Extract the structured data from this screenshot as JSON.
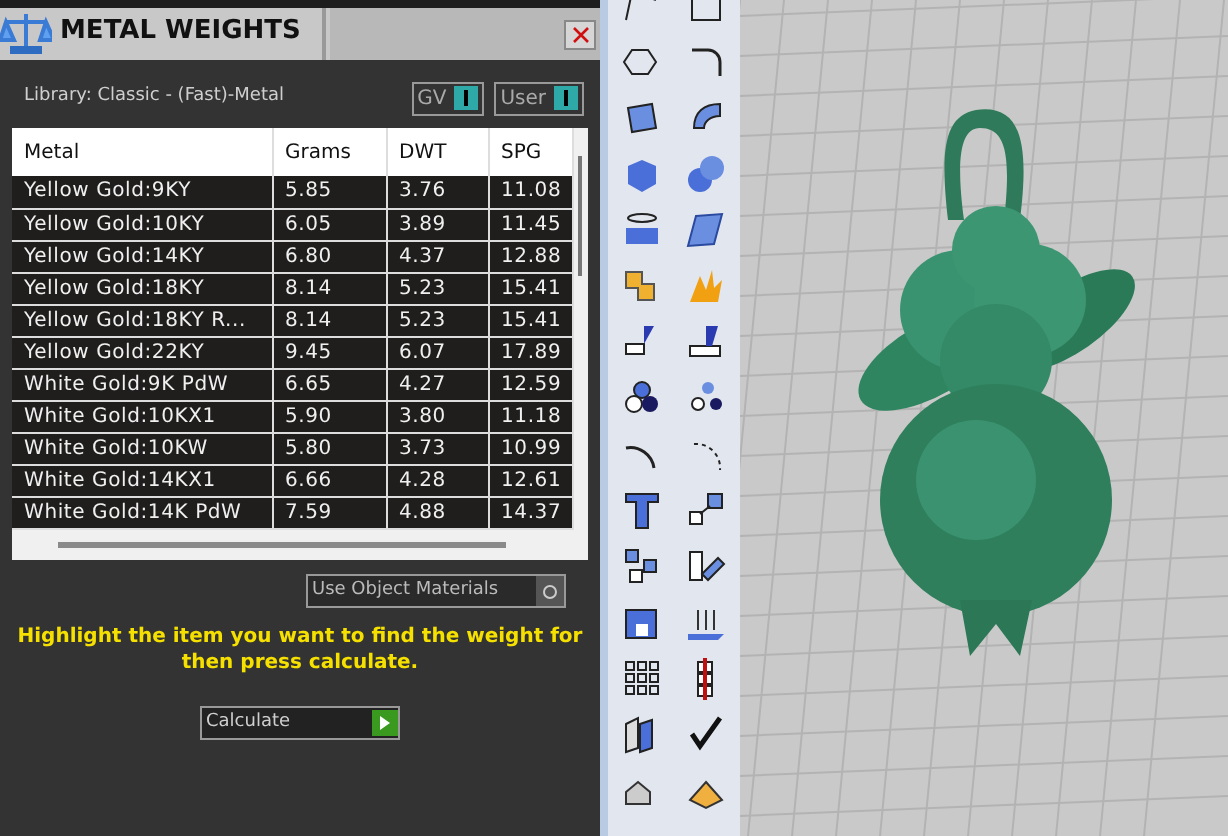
{
  "panel": {
    "title": "METAL WEIGHTS",
    "library": "Library: Classic - (Fast)-Metal",
    "toggles": [
      {
        "label": "GV",
        "on": true
      },
      {
        "label": "User",
        "on": true
      }
    ],
    "table": {
      "columns": [
        "Metal",
        "Grams",
        "DWT",
        "SPG"
      ],
      "rows": [
        [
          "Yellow Gold:9KY",
          "5.85",
          "3.76",
          "11.08"
        ],
        [
          "Yellow Gold:10KY",
          "6.05",
          "3.89",
          "11.45"
        ],
        [
          "Yellow Gold:14KY",
          "6.80",
          "4.37",
          "12.88"
        ],
        [
          "Yellow Gold:18KY",
          "8.14",
          "5.23",
          "15.41"
        ],
        [
          "Yellow Gold:18KY R...",
          "8.14",
          "5.23",
          "15.41"
        ],
        [
          "Yellow Gold:22KY",
          "9.45",
          "6.07",
          "17.89"
        ],
        [
          "White Gold:9K PdW",
          "6.65",
          "4.27",
          "12.59"
        ],
        [
          "White Gold:10KX1",
          "5.90",
          "3.80",
          "11.18"
        ],
        [
          "White Gold:10KW",
          "5.80",
          "3.73",
          "10.99"
        ],
        [
          "White Gold:14KX1",
          "6.66",
          "4.28",
          "12.61"
        ],
        [
          "White Gold:14K PdW",
          "7.59",
          "4.88",
          "14.37"
        ]
      ]
    },
    "use_object_materials": {
      "label": "Use Object Materials",
      "on": false
    },
    "instruction": "Highlight the item you want to find the weight for then press calculate.",
    "calculate": "Calculate"
  }
}
